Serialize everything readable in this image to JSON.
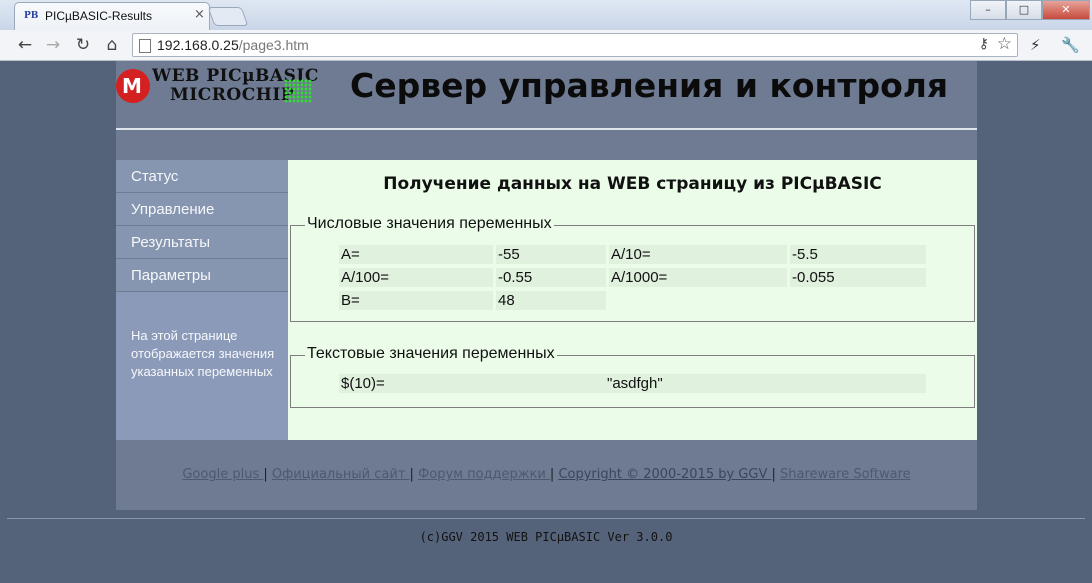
{
  "browser": {
    "tab_title": "PICµBASIC-Results",
    "tab_favicon": "PB",
    "url_host": "192.168.0.25",
    "url_path": "/page3.htm",
    "icons": [
      "back-icon",
      "forward-icon",
      "reload-icon",
      "home-icon",
      "page-icon",
      "key-icon",
      "star-icon",
      "lightning-icon",
      "wrench-icon"
    ],
    "window_controls": [
      "minimize-icon",
      "maximize-icon",
      "close-icon"
    ]
  },
  "header": {
    "logo_line1": "WEB PICµBASIC",
    "logo_line2": "MICROCHIP",
    "logo_mark": "M",
    "title": "Сервер управления и контроля"
  },
  "sidebar": {
    "items": [
      {
        "label": "Статус"
      },
      {
        "label": "Управление"
      },
      {
        "label": "Результаты"
      },
      {
        "label": "Параметры"
      }
    ],
    "note": "На этой странице отображается значения указанных переменных"
  },
  "content": {
    "title": "Получение данных на WEB страницу из PICµBASIC",
    "numeric": {
      "legend": "Числовые значения переменных",
      "rows": [
        {
          "label1": "A=",
          "value1": "-55",
          "label2": "A/10=",
          "value2": "-5.5"
        },
        {
          "label1": "A/100=",
          "value1": "-0.55",
          "label2": "A/1000=",
          "value2": "-0.055"
        },
        {
          "label1": "B=",
          "value1": "48"
        }
      ]
    },
    "text": {
      "legend": "Текстовые значения переменных",
      "rows": [
        {
          "label": "$(10)=",
          "value": "\"asdfgh\""
        }
      ]
    }
  },
  "footer": {
    "links": [
      {
        "label": "Google plus "
      },
      {
        "label": "Официальный сайт "
      },
      {
        "label": "Форум поддержки "
      },
      {
        "label": "Copyright © 2000-2015 by GGV "
      },
      {
        "label": "Shareware Software"
      }
    ],
    "separator": "|",
    "copyright": "(c)GGV 2015 WEB PICµBASIC Ver 3.0.0"
  },
  "colors": {
    "page_bg": "#55637a",
    "container_bg": "#6e7b93",
    "sidebar_bg": "#8796b0",
    "content_bg": "#ebfde9",
    "cell_bg": "#e0f1de",
    "logo_red": "#d42020",
    "logo_green": "#2ee02e"
  }
}
